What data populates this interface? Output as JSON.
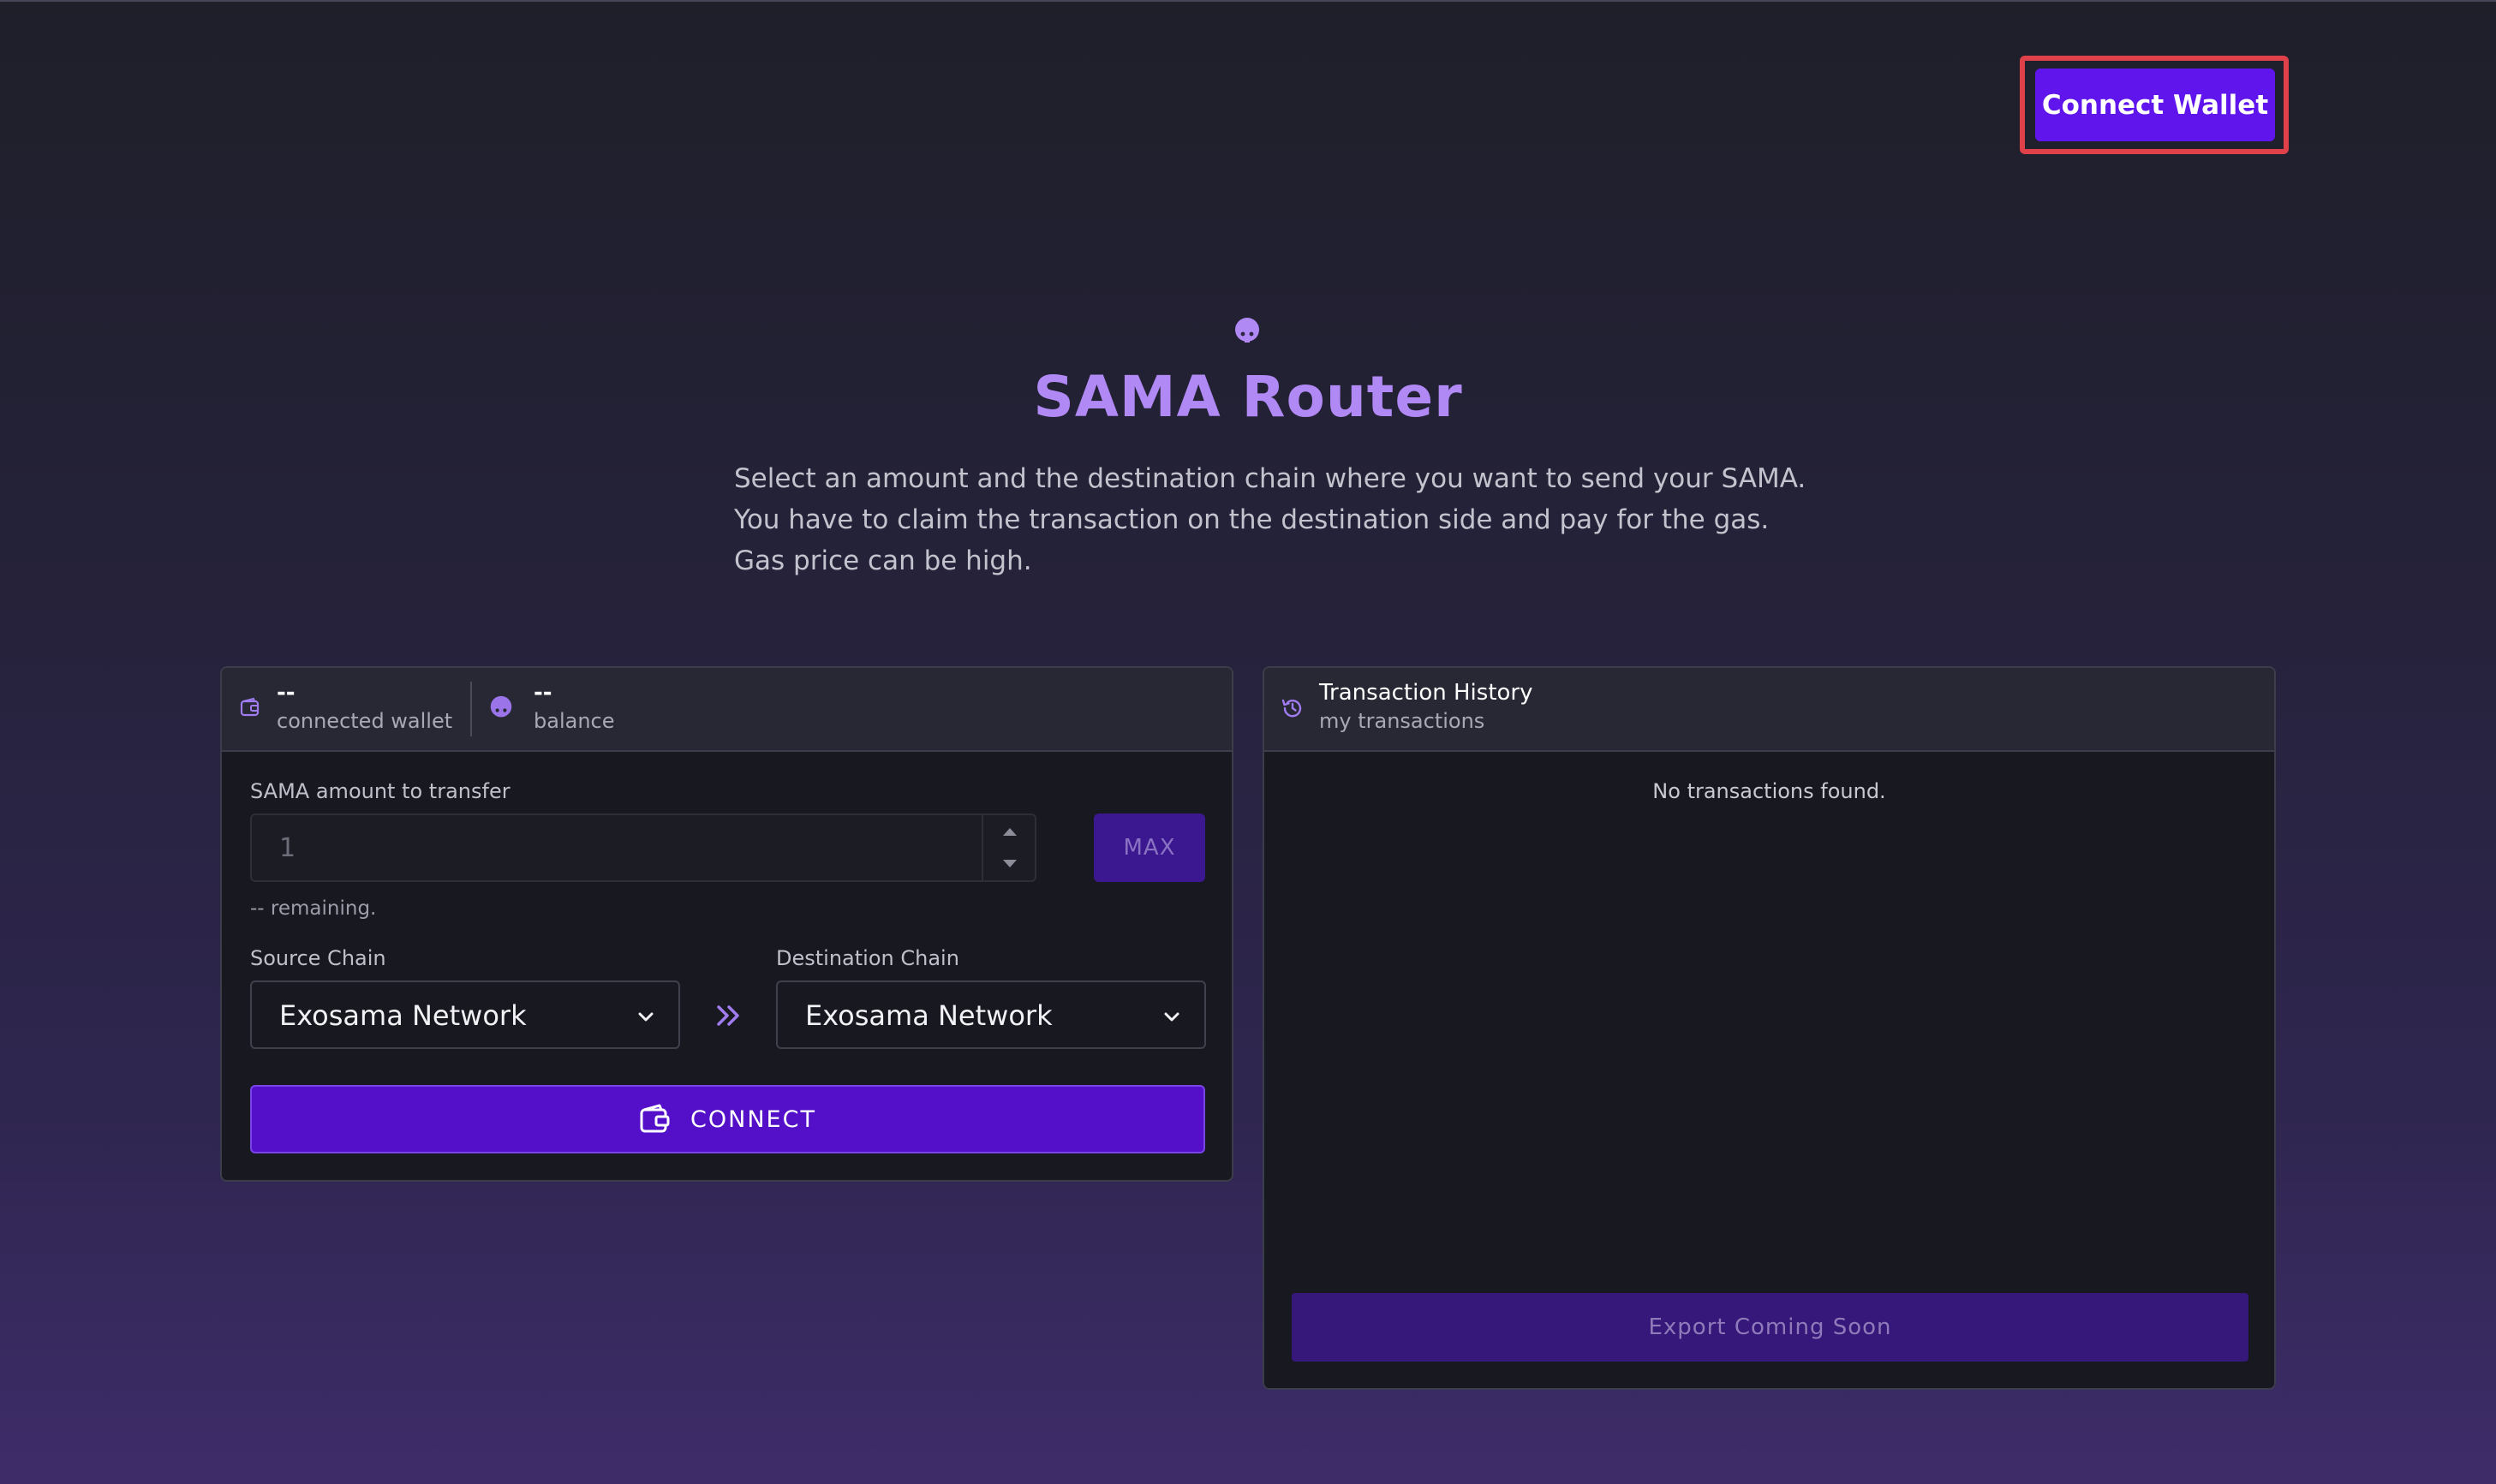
{
  "header": {
    "connect_wallet_label": "Connect Wallet"
  },
  "hero": {
    "icon": "sama-logo-icon",
    "title": "SAMA Router",
    "description_lines": [
      "Select an amount and the destination chain where you want to send your SAMA.",
      "You have to claim the transaction on the destination side and pay for the gas.",
      "Gas price can be high."
    ]
  },
  "transfer": {
    "wallet": {
      "value": "--",
      "label": "connected wallet",
      "icon": "wallet-icon"
    },
    "balance": {
      "value": "--",
      "label": "balance",
      "icon": "sama-logo-icon"
    },
    "amount": {
      "label": "SAMA amount to transfer",
      "placeholder": "1",
      "max_label": "MAX",
      "remaining": "-- remaining."
    },
    "source": {
      "label": "Source Chain",
      "value": "Exosama Network"
    },
    "destination": {
      "label": "Destination Chain",
      "value": "Exosama Network"
    },
    "connect_label": "CONNECT"
  },
  "history": {
    "title": "Transaction History",
    "subtitle": "my transactions",
    "icon": "history-icon",
    "empty": "No transactions found.",
    "export_label": "Export Coming Soon"
  },
  "colors": {
    "accent": "#5f15eb",
    "title_purple": "#b089f5",
    "highlight": "#e0404a"
  }
}
